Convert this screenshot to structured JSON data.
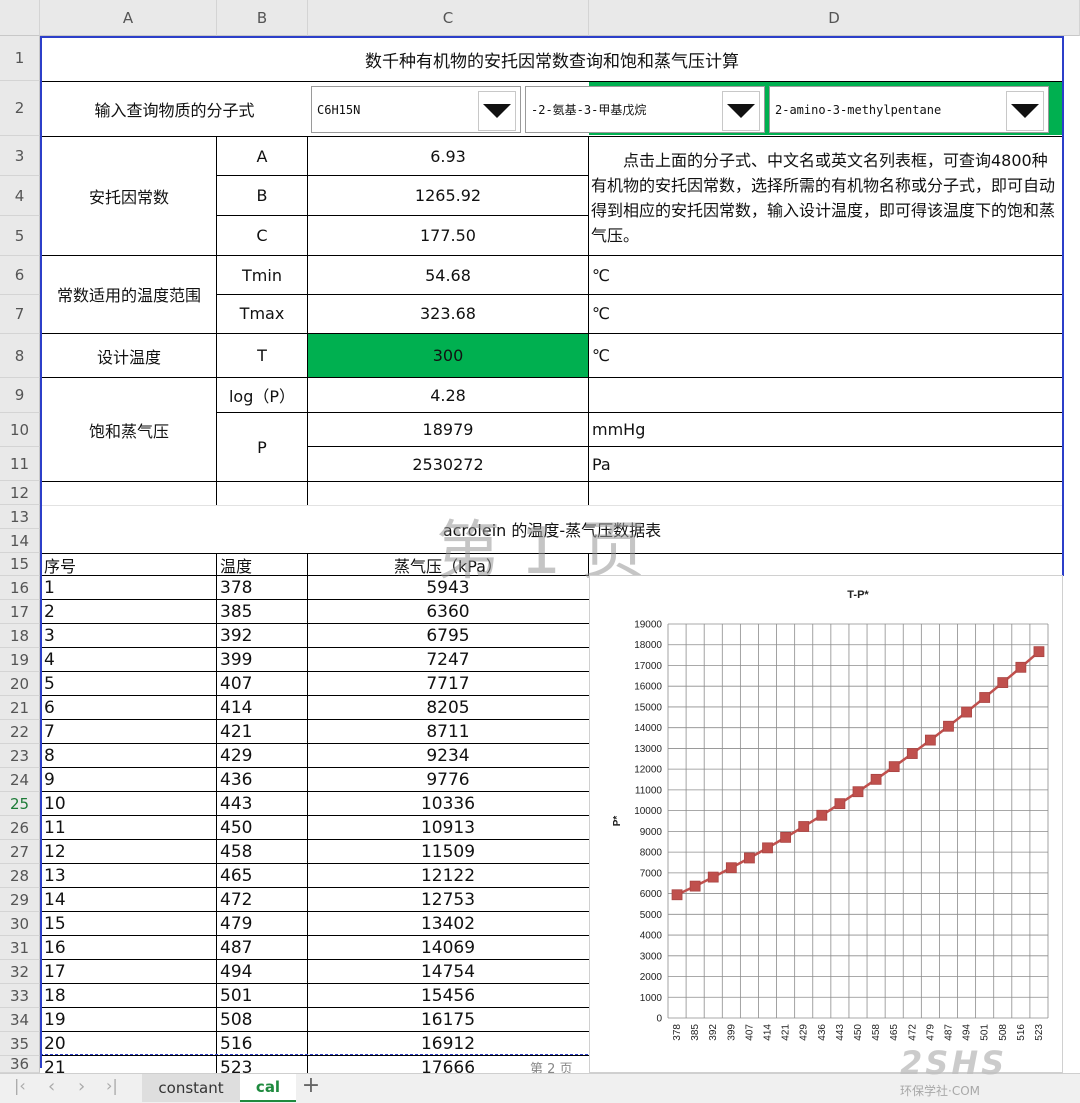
{
  "columns": [
    "A",
    "B",
    "C",
    "D"
  ],
  "rows": [
    "1",
    "2",
    "3",
    "4",
    "5",
    "6",
    "7",
    "8",
    "9",
    "10",
    "11",
    "12",
    "13",
    "14",
    "15",
    "16",
    "17",
    "18",
    "19",
    "20",
    "21",
    "22",
    "23",
    "24",
    "25",
    "26",
    "27",
    "28",
    "29",
    "30",
    "31",
    "32",
    "33",
    "34",
    "35",
    "36"
  ],
  "title": "数千种有机物的安托因常数查询和饱和蒸气压计算",
  "query": {
    "label": "输入查询物质的分子式",
    "formula": "C6H15N",
    "chinese_name": "-2-氨基-3-甲基戊烷",
    "english_name": "2-amino-3-methylpentane"
  },
  "antoine": {
    "label": "安托因常数",
    "A_label": "A",
    "A": "6.93",
    "B_label": "B",
    "B": "1265.92",
    "C_label": "C",
    "C": "177.50",
    "note": "点击上面的分子式、中文名或英文名列表框，可查询4800种有机物的安托因常数，选择所需的有机物名称或分子式，即可自动得到相应的安托因常数，输入设计温度，即可得该温度下的饱和蒸气压。"
  },
  "range": {
    "label": "常数适用的温度范围",
    "tmin_label": "Tmin",
    "tmin": "54.68",
    "tmin_unit": "℃",
    "tmax_label": "Tmax",
    "tmax": "323.68",
    "tmax_unit": "℃"
  },
  "design": {
    "label": "设计温度",
    "t_label": "T",
    "t": "300",
    "unit": "℃"
  },
  "pressure": {
    "label": "饱和蒸气压",
    "logp_label": "log（P）",
    "logp": "4.28",
    "p_label": "P",
    "p_mmhg": "18979",
    "mmhg_unit": "mmHg",
    "p_pa": "2530272",
    "pa_unit": "Pa"
  },
  "table": {
    "title": "acrolein 的温度-蒸气压数据表",
    "headers": [
      "序号",
      "温度",
      "蒸气压（kPa）"
    ],
    "rows": [
      [
        "1",
        "378",
        "5943"
      ],
      [
        "2",
        "385",
        "6360"
      ],
      [
        "3",
        "392",
        "6795"
      ],
      [
        "4",
        "399",
        "7247"
      ],
      [
        "5",
        "407",
        "7717"
      ],
      [
        "6",
        "414",
        "8205"
      ],
      [
        "7",
        "421",
        "8711"
      ],
      [
        "8",
        "429",
        "9234"
      ],
      [
        "9",
        "436",
        "9776"
      ],
      [
        "10",
        "443",
        "10336"
      ],
      [
        "11",
        "450",
        "10913"
      ],
      [
        "12",
        "458",
        "11509"
      ],
      [
        "13",
        "465",
        "12122"
      ],
      [
        "14",
        "472",
        "12753"
      ],
      [
        "15",
        "479",
        "13402"
      ],
      [
        "16",
        "487",
        "14069"
      ],
      [
        "17",
        "494",
        "14754"
      ],
      [
        "18",
        "501",
        "15456"
      ],
      [
        "19",
        "508",
        "16175"
      ],
      [
        "20",
        "516",
        "16912"
      ],
      [
        "21",
        "523",
        "17666"
      ]
    ]
  },
  "page_labels": {
    "page1": "第 1 页",
    "page2": "第 2 页"
  },
  "sheet_tabs": [
    "constant",
    "cal"
  ],
  "active_tab": "cal",
  "brand_watermark": "环保学社·COM",
  "colors": {
    "accent_green": "#00b050",
    "marker": "#c0504d",
    "active_tab_text": "#1e8a3e",
    "frame_blue": "#2c3fc9"
  },
  "chart_data": {
    "type": "line",
    "title": "T-P*",
    "xlabel": "",
    "ylabel": "P*",
    "x": [
      378,
      385,
      392,
      399,
      407,
      414,
      421,
      429,
      436,
      443,
      450,
      458,
      465,
      472,
      479,
      487,
      494,
      501,
      508,
      516,
      523
    ],
    "series": [
      {
        "values": [
          5943,
          6360,
          6795,
          7247,
          7717,
          8205,
          8711,
          9234,
          9776,
          10336,
          10913,
          11509,
          12122,
          12753,
          13402,
          14069,
          14754,
          15456,
          16175,
          16912,
          17666
        ]
      }
    ],
    "ylim": [
      0,
      19000
    ],
    "yticks": [
      0,
      1000,
      2000,
      3000,
      4000,
      5000,
      6000,
      7000,
      8000,
      9000,
      10000,
      11000,
      12000,
      13000,
      14000,
      15000,
      16000,
      17000,
      18000,
      19000
    ],
    "grid": true
  }
}
